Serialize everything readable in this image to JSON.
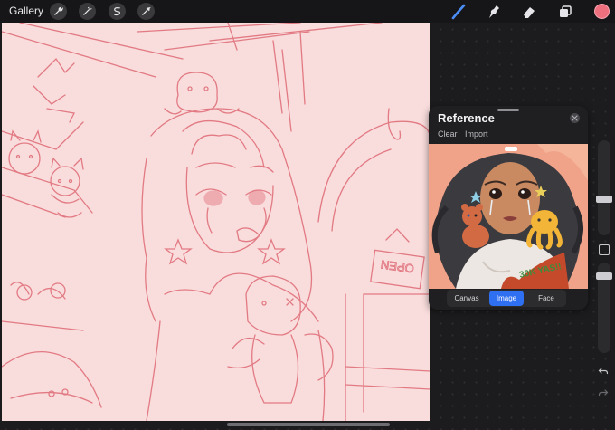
{
  "toolbar": {
    "gallery_label": "Gallery",
    "left_tools": [
      "wrench-icon",
      "magic-wand-icon",
      "selection-icon",
      "transform-icon"
    ],
    "right_tools": [
      "brush-icon",
      "smudge-icon",
      "eraser-icon",
      "layers-icon"
    ],
    "active_tool": "brush-icon",
    "active_color": "#ee6f7e"
  },
  "reference_panel": {
    "title": "Reference",
    "actions": [
      "Clear",
      "Import"
    ],
    "tabs": [
      "Canvas",
      "Image",
      "Face"
    ],
    "active_tab": "Image",
    "image_text": "30K YAS!!"
  },
  "canvas": {
    "background_color": "#f9dcdc",
    "sketch_color": "#e0707a",
    "sign_text": "OPEN"
  },
  "colors": {
    "accent": "#2f6ff1",
    "brush_active": "#4b8ef5"
  }
}
